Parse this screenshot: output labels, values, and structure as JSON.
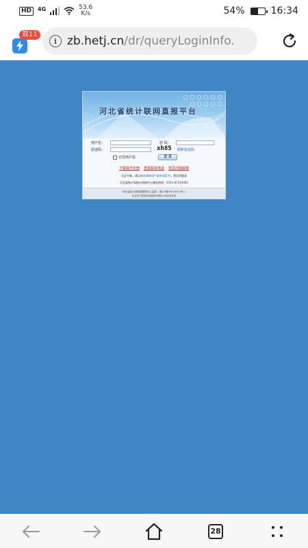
{
  "status_bar": {
    "hd_label": "HD",
    "network_type": "4G",
    "speed_value": "53.6",
    "speed_unit": "K/s",
    "battery_percent": "54%",
    "battery_level": 0.54,
    "time": "16:34"
  },
  "browser": {
    "app_badge": "双11",
    "url_host": "zb.hetj.cn",
    "url_path": "/dr/queryLoginInfo.",
    "info_icon": "i"
  },
  "login_panel": {
    "title": "河北省统计联网直报平台",
    "username_label": "用户名：",
    "password_label": "密 码：",
    "captcha_label": "验证码：",
    "captcha_value": "xh85",
    "captcha_refresh": "刷新验证码",
    "remember_label": "记住用户名",
    "login_button": "登 录",
    "links": [
      "下载操作手册",
      "查看联系电话",
      "常见问题解答"
    ],
    "notice_prefix": "无证书者，请点击",
    "notice_link": "申请新用户或申请证书",
    "notice_suffix": "，然后再登录",
    "contact": "河北省统计局统计网络中心服务热线：0311-87244462",
    "footer_line1": "河北省统计局数据管理中心监制　冀ICP备06024502号-1",
    "footer_line2": "北京东方国信科技股份有限公司技术支持"
  },
  "bottom_nav": {
    "tab_count": "28"
  },
  "colors": {
    "page_background": "#3f86c4",
    "link_red": "#c0241b",
    "badge_red": "#f0473a",
    "app_blue": "#2a8cf0"
  },
  "icons": [
    "back-arrow-icon",
    "forward-arrow-icon",
    "home-icon",
    "tabs-icon",
    "menu-dots-icon",
    "reload-icon",
    "info-icon",
    "wifi-icon",
    "signal-icon",
    "battery-icon"
  ]
}
